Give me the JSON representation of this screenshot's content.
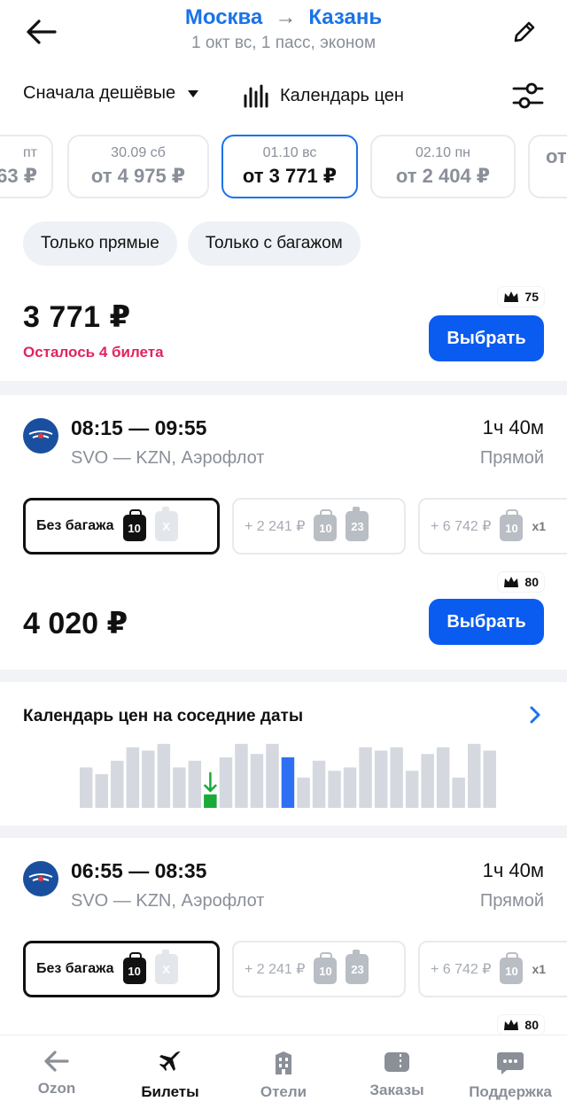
{
  "header": {
    "from": "Москва",
    "to": "Казань",
    "subtitle": "1 окт вс, 1 пасс, эконом"
  },
  "sort": {
    "label": "Сначала дешёвые",
    "calendar_label": "Календарь цен"
  },
  "dates": [
    {
      "day": "пт",
      "price": "63 ₽"
    },
    {
      "day": "30.09 сб",
      "price": "от 4 975 ₽"
    },
    {
      "day": "01.10 вс",
      "price": "от 3 771 ₽",
      "selected": true
    },
    {
      "day": "02.10 пн",
      "price": "от 2 404 ₽"
    },
    {
      "day": "",
      "price": "от"
    }
  ],
  "chips": [
    "Только прямые",
    "Только с багажом"
  ],
  "offer_top": {
    "price": "3 771 ₽",
    "tickets_left": "Осталось 4 билета",
    "points": "75",
    "button": "Выбрать"
  },
  "flights": [
    {
      "times": "08:15 — 09:55",
      "route": "SVO — KZN, Аэрофлот",
      "duration": "1ч 40м",
      "type": "Прямой",
      "fares": [
        {
          "label": "Без багажа",
          "bag": "10",
          "case": "X"
        },
        {
          "label": "+ 2 241 ₽",
          "bag": "10",
          "case": "23"
        },
        {
          "label": "+ 6 742 ₽",
          "bag": "10",
          "extra": "x1"
        }
      ],
      "points": "80",
      "price": "4 020 ₽",
      "button": "Выбрать"
    },
    {
      "times": "06:55 — 08:35",
      "route": "SVO — KZN, Аэрофлот",
      "duration": "1ч 40м",
      "type": "Прямой",
      "fares": [
        {
          "label": "Без багажа",
          "bag": "10",
          "case": "X"
        },
        {
          "label": "+ 2 241 ₽",
          "bag": "10",
          "case": "23"
        },
        {
          "label": "+ 6 742 ₽",
          "bag": "10",
          "extra": "x1"
        }
      ],
      "points": "80"
    }
  ],
  "calendar": {
    "title": "Календарь цен на соседние даты",
    "bars": [
      0.6,
      0.5,
      0.7,
      0.9,
      0.85,
      0.95,
      0.6,
      0.7,
      0.2,
      0.75,
      0.95,
      0.8,
      0.95,
      0.75,
      0.45,
      0.7,
      0.55,
      0.6,
      0.9,
      0.85,
      0.9,
      0.55,
      0.8,
      0.9,
      0.45,
      0.95,
      0.85
    ],
    "cheapest_index": 8,
    "selected_index": 13,
    "colors": {
      "bar": "#d5d9df",
      "cheapest": "#1aaa3a",
      "selected": "#2f6ff3"
    }
  },
  "tabs": [
    {
      "label": "Ozon",
      "icon": "arrow-left-icon"
    },
    {
      "label": "Билеты",
      "icon": "plane-icon",
      "active": true
    },
    {
      "label": "Отели",
      "icon": "hotel-icon"
    },
    {
      "label": "Заказы",
      "icon": "ticket-icon"
    },
    {
      "label": "Поддержка",
      "icon": "chat-icon"
    }
  ],
  "colors": {
    "accent": "#1a73e8",
    "button": "#0a5bf0",
    "alert": "#e0245e"
  }
}
